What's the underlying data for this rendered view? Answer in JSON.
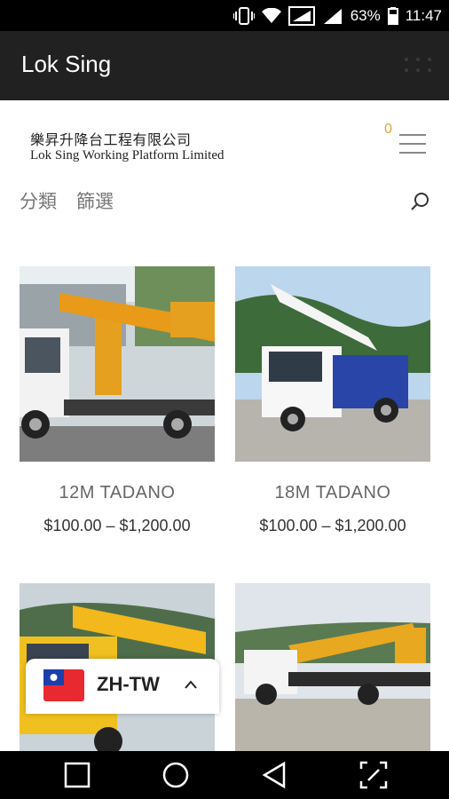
{
  "status_bar": {
    "battery": "63%",
    "time": "11:47",
    "icons": [
      "vibrate-icon",
      "wifi-icon",
      "signal-icon",
      "battery-icon"
    ]
  },
  "app_bar": {
    "title": "Lok Sing"
  },
  "site": {
    "logo_zh": "樂昇升降台工程有限公司",
    "logo_en": "Lok Sing Working Platform Limited",
    "cart_count": "0"
  },
  "filters": {
    "category": "分類",
    "filter": "篩選"
  },
  "products": [
    {
      "name": "12M TADANO",
      "price": "$100.00 – $1,200.00"
    },
    {
      "name": "18M TADANO",
      "price": "$100.00 – $1,200.00"
    },
    {
      "name": "",
      "price": ""
    },
    {
      "name": "",
      "price": ""
    }
  ],
  "language": {
    "code": "ZH-TW"
  },
  "colors": {
    "appbar": "#212121",
    "accent": "#e0a33a",
    "truck_yellow": "#f0a020"
  }
}
